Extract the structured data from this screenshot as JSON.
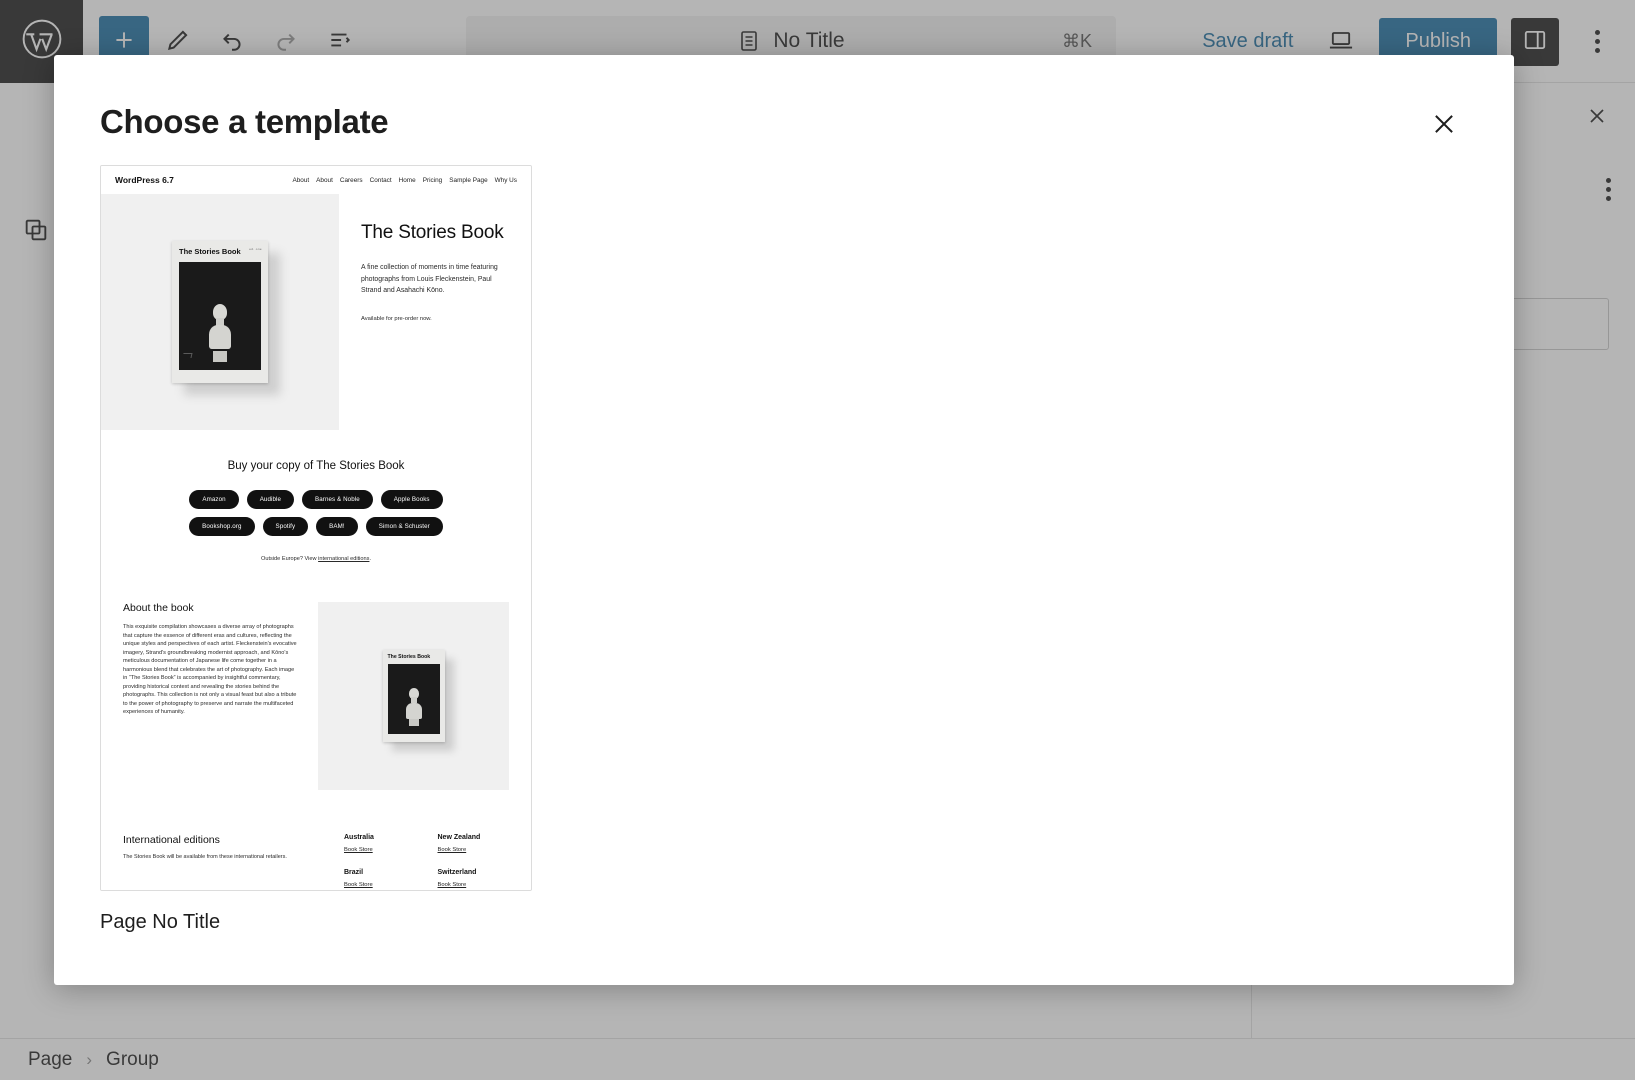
{
  "editor": {
    "toolbar": {
      "add_block_label": "+",
      "tools_label": "Tools",
      "undo_label": "Undo",
      "redo_label": "Redo",
      "list_view_label": "Document Overview",
      "document_title": "No Title",
      "command_shortcut": "⌘K",
      "save_draft_label": "Save draft",
      "preview_label": "Preview",
      "publish_label": "Publish",
      "settings_label": "Settings",
      "options_label": "Options"
    },
    "canvas": {
      "partial_text": "Available for pre-order now."
    },
    "breadcrumb": {
      "items": [
        "Page",
        "Group"
      ],
      "separator": "›"
    },
    "accent_color": "#1d6fa3"
  },
  "modal": {
    "title": "Choose a template",
    "close_label": "Close",
    "templates": [
      {
        "caption": "Page No Title",
        "preview": {
          "site_title": "WordPress 6.7",
          "nav": [
            "About",
            "About",
            "Careers",
            "Contact",
            "Home",
            "Pricing",
            "Sample Page",
            "Why Us"
          ],
          "hero": {
            "heading": "The Stories Book",
            "lede": "A fine collection of moments in time featuring photographs from Louis Fleckenstein, Paul Strand and Asahachi Kōno.",
            "availability": "Available for pre-order now.",
            "book_cover_title": "The Stories Book",
            "book_cover_corner": "ed. one"
          },
          "buy": {
            "heading": "Buy your copy of The Stories Book",
            "retailers_row1": [
              "Amazon",
              "Audible",
              "Barnes & Noble",
              "Apple Books"
            ],
            "retailers_row2": [
              "Bookshop.org",
              "Spotify",
              "BAM!",
              "Simon & Schuster"
            ],
            "note_prefix": "Outside Europe? View ",
            "note_link": "international editions",
            "note_suffix": "."
          },
          "about": {
            "heading": "About the book",
            "body": "This exquisite compilation showcases a diverse array of photographs that capture the essence of different eras and cultures, reflecting the unique styles and perspectives of each artist. Fleckenstein's evocative imagery, Strand's groundbreaking modernist approach, and Kōno's meticulous documentation of Japanese life come together in a harmonious blend that celebrates the art of photography. Each image in “The Stories Book” is accompanied by insightful commentary, providing historical context and revealing the stories behind the photographs. This collection is not only a visual feast but also a tribute to the power of photography to preserve and narrate the multifaceted experiences of humanity."
          },
          "international": {
            "heading": "International editions",
            "subtext": "The Stories Book will be available from these international retailers.",
            "entries": [
              {
                "country": "Australia",
                "link": "Book Store"
              },
              {
                "country": "New Zealand",
                "link": "Book Store"
              },
              {
                "country": "Brazil",
                "link": "Book Store"
              },
              {
                "country": "Switzerland",
                "link": "Book Store"
              }
            ]
          }
        }
      }
    ]
  }
}
